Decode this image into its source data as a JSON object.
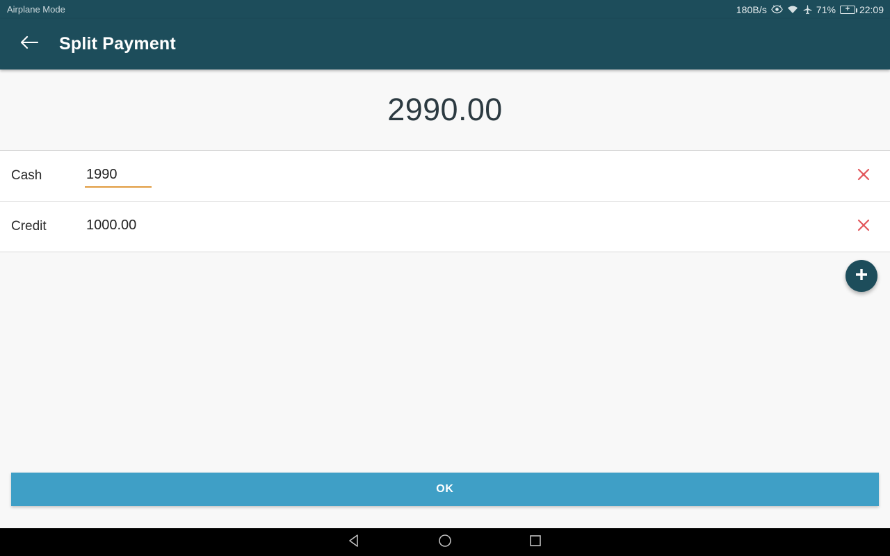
{
  "statusbar": {
    "left_label": "Airplane Mode",
    "network_speed": "180B/s",
    "battery_percent": "71%",
    "time": "22:09",
    "icons": [
      "eye-icon",
      "wifi-icon",
      "airplane-icon",
      "battery-charging-icon"
    ]
  },
  "appbar": {
    "back_icon": "arrow-left-icon",
    "title": "Split Payment",
    "background_color": "#1d4d5b"
  },
  "total": {
    "amount": "2990.00"
  },
  "payments": {
    "rows": [
      {
        "label": "Cash",
        "value": "1990",
        "focused": true,
        "delete_icon": "close-icon"
      },
      {
        "label": "Credit",
        "value": "1000.00",
        "focused": false,
        "delete_icon": "close-icon"
      }
    ]
  },
  "fab": {
    "icon": "plus-icon",
    "color": "#1d4d5b"
  },
  "footer": {
    "ok_label": "OK",
    "ok_color": "#3f9fc6"
  },
  "navbar": {
    "back_icon": "triangle-back-icon",
    "home_icon": "circle-home-icon",
    "recents_icon": "square-recents-icon"
  },
  "colors": {
    "accent_underline": "#e09a3e",
    "delete_red": "#e2555a",
    "primary": "#1d4d5b",
    "page_bg": "#f8f8f8"
  }
}
